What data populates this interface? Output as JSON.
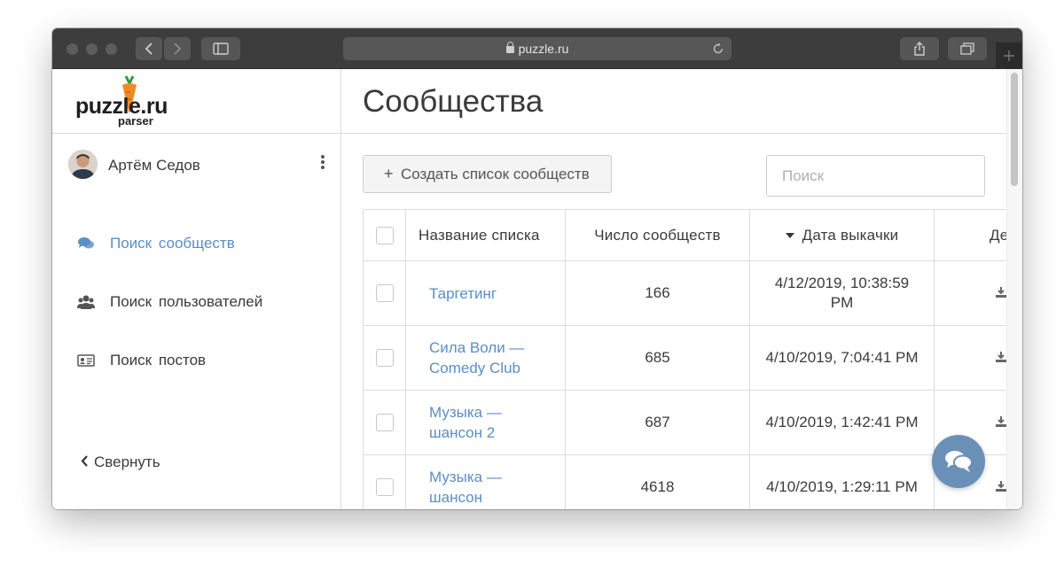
{
  "browser": {
    "url": "puzzle.ru"
  },
  "sidebar": {
    "logo_text": "puzzle.ru",
    "logo_sub": "parser",
    "user_name": "Артём Седов",
    "nav": [
      {
        "label": "Поиск сообществ",
        "icon": "comments-icon",
        "active": true
      },
      {
        "label": "Поиск пользователей",
        "icon": "users-icon",
        "active": false
      },
      {
        "label": "Поиск постов",
        "icon": "id-card-icon",
        "active": false
      }
    ],
    "collapse_label": "Свернуть"
  },
  "main": {
    "title": "Сообщества",
    "create_button": "Создать список сообществ",
    "search_placeholder": "Поиск",
    "table": {
      "columns": [
        "Название списка",
        "Число сообществ",
        "Дата выкачки",
        "Де"
      ],
      "sort_column": "Дата выкачки",
      "rows": [
        {
          "name": "Таргетинг",
          "count": "166",
          "date": "4/12/2019, 10:38:59 PM"
        },
        {
          "name": "Сила Воли — Comedy Club",
          "count": "685",
          "date": "4/10/2019, 7:04:41 PM"
        },
        {
          "name": "Музыка — шансон 2",
          "count": "687",
          "date": "4/10/2019, 1:42:41 PM"
        },
        {
          "name": "Музыка — шансон",
          "count": "4618",
          "date": "4/10/2019, 1:29:11 PM"
        }
      ]
    }
  },
  "colors": {
    "accent": "#5a8ec5",
    "chat_button": "#6b90b8",
    "titlebar": "#3d3d3d"
  }
}
